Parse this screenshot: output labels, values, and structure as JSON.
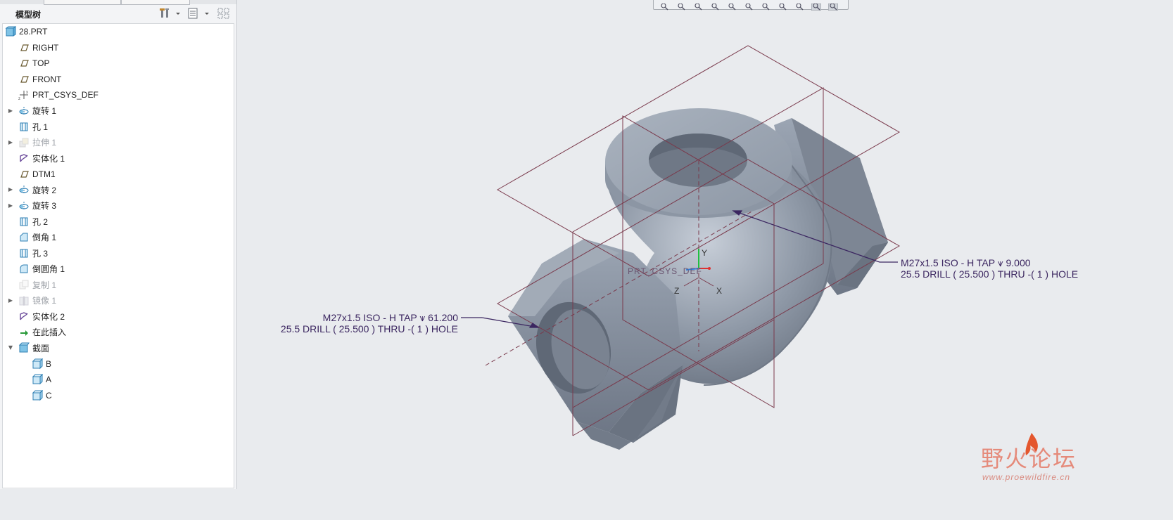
{
  "window": {
    "panel_title": "模型树"
  },
  "tree_header": {
    "tool_icons": [
      "settings-hammer-icon",
      "dropdown-arrow-icon",
      "tree-columns-icon",
      "dropdown-arrow-icon",
      "filter-grid-icon"
    ]
  },
  "tree": {
    "items": [
      {
        "label": "28.PRT",
        "icon": "part-icon",
        "expander": "",
        "dim": false
      },
      {
        "label": "RIGHT",
        "icon": "datum-plane-icon",
        "expander": "",
        "dim": false
      },
      {
        "label": "TOP",
        "icon": "datum-plane-icon",
        "expander": "",
        "dim": false
      },
      {
        "label": "FRONT",
        "icon": "datum-plane-icon",
        "expander": "",
        "dim": false
      },
      {
        "label": "PRT_CSYS_DEF",
        "icon": "coordinate-system-icon",
        "expander": "",
        "dim": false
      },
      {
        "label": "旋转 1",
        "icon": "revolve-icon",
        "expander": "collapsed",
        "dim": false
      },
      {
        "label": "孔 1",
        "icon": "hole-icon",
        "expander": "",
        "dim": false
      },
      {
        "label": "拉伸 1",
        "icon": "extrude-icon",
        "expander": "collapsed",
        "dim": true
      },
      {
        "label": "实体化 1",
        "icon": "solidify-icon",
        "expander": "",
        "dim": false
      },
      {
        "label": "DTM1",
        "icon": "datum-plane-icon",
        "expander": "",
        "dim": false
      },
      {
        "label": "旋转 2",
        "icon": "revolve-icon",
        "expander": "collapsed",
        "dim": false
      },
      {
        "label": "旋转 3",
        "icon": "revolve-icon",
        "expander": "collapsed",
        "dim": false
      },
      {
        "label": "孔 2",
        "icon": "hole-icon",
        "expander": "",
        "dim": false
      },
      {
        "label": "倒角 1",
        "icon": "chamfer-icon",
        "expander": "",
        "dim": false
      },
      {
        "label": "孔 3",
        "icon": "hole-icon",
        "expander": "",
        "dim": false
      },
      {
        "label": "倒圆角 1",
        "icon": "round-icon",
        "expander": "",
        "dim": false
      },
      {
        "label": "复制 1",
        "icon": "copy-icon",
        "expander": "",
        "dim": true
      },
      {
        "label": "镜像 1",
        "icon": "mirror-icon",
        "expander": "collapsed",
        "dim": true
      },
      {
        "label": "实体化 2",
        "icon": "solidify-icon",
        "expander": "",
        "dim": false
      },
      {
        "label": "在此插入",
        "icon": "insert-here-arrow-icon",
        "expander": "",
        "dim": false
      },
      {
        "label": "截面",
        "icon": "section-folder-icon",
        "expander": "expanded",
        "dim": false
      },
      {
        "label": "B",
        "icon": "section-icon",
        "expander": "",
        "dim": false
      },
      {
        "label": "A",
        "icon": "section-icon",
        "expander": "",
        "dim": false
      },
      {
        "label": "C",
        "icon": "section-icon",
        "expander": "",
        "dim": false
      }
    ]
  },
  "view_toolbar": {
    "icons": [
      "refit-icon",
      "zoom-in-icon",
      "zoom-out-icon",
      "repaint-icon",
      "display-style-icon",
      "saved-views-icon",
      "view-manager-icon",
      "perspective-icon",
      "datum-display-icon",
      "annotation-display-icon",
      "spin-center-icon"
    ]
  },
  "model": {
    "csys_label": "PRT_CSYS_DEF",
    "axis_x": "X",
    "axis_y": "Y",
    "axis_z": "Z"
  },
  "annotations": {
    "note1_line1": "M27x1.5 ISO - H TAP ⩛ 9.000",
    "note1_line2": "25.5 DRILL ( 25.500 )  THRU  -( 1 ) HOLE",
    "note2_line1": "M27x1.5 ISO - H TAP ⩛ 61.200",
    "note2_line2": "25.5 DRILL ( 25.500 )  THRU  -( 1 ) HOLE"
  },
  "watermark": {
    "text_cn": "野火论坛",
    "url": "www.proewildfire.cn"
  },
  "colors": {
    "model_fill": "#9aa4b1",
    "datum_lines": "#7a3a4c",
    "annotation": "#3b2660",
    "tree_bg": "#ffffff"
  }
}
